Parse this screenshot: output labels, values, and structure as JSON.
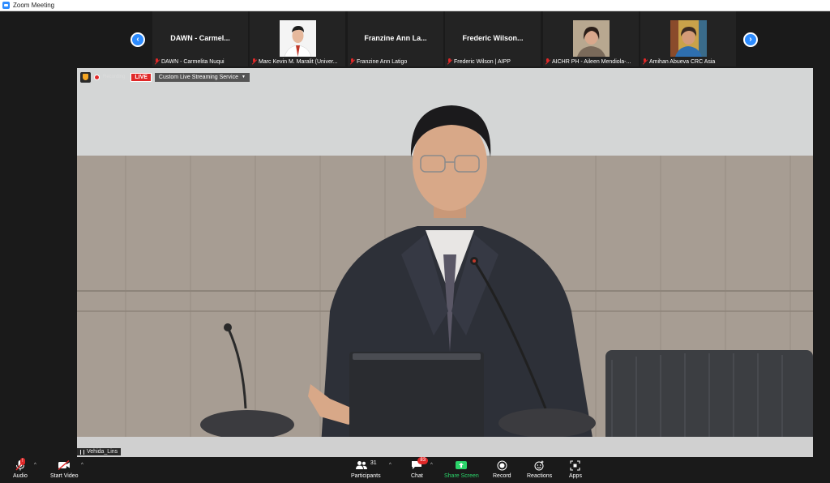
{
  "window": {
    "title": "Zoom Meeting"
  },
  "participants_strip": [
    {
      "display": "DAWN - Carmel...",
      "caption": "DAWN - Carmelita Nuqui",
      "has_photo": false
    },
    {
      "display": "",
      "caption": "Marc Kevin M. Maralit (Univer...",
      "has_photo": true
    },
    {
      "display": "Franzine Ann La...",
      "caption": "Franzine Ann Latigo",
      "has_photo": false
    },
    {
      "display": "Frederic Wilson...",
      "caption": "Frederic Wilson | AIPP",
      "has_photo": false
    },
    {
      "display": "",
      "caption": "AICHR PH - Aileen Mendiola-...",
      "has_photo": true
    },
    {
      "display": "",
      "caption": "Amihan Abueva CRC Asia",
      "has_photo": true
    }
  ],
  "recording": {
    "status": "Recording",
    "live_label": "LIVE",
    "stream_service": "Custom Live Streaming Service"
  },
  "active_speaker": {
    "name": "Vehida_Lins"
  },
  "toolbar": {
    "audio": "Audio",
    "start_video": "Start Video",
    "participants": "Participants",
    "participants_count": "31",
    "chat": "Chat",
    "chat_badge": "83",
    "share_screen": "Share Screen",
    "record": "Record",
    "reactions": "Reactions",
    "apps": "Apps"
  },
  "colors": {
    "accent": "#2d8cff",
    "live": "#e02828",
    "share": "#2bd46a"
  }
}
